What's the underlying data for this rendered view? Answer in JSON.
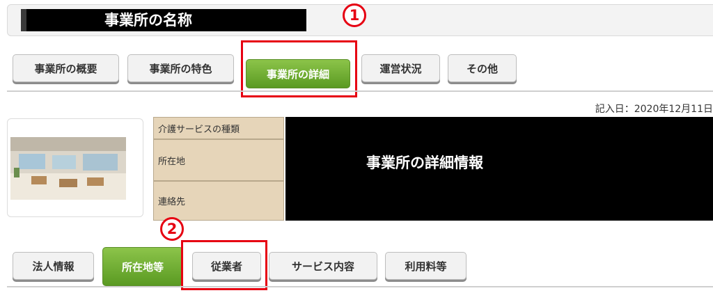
{
  "header": {
    "facility_name": "事業所の名称"
  },
  "main_tabs": [
    {
      "label": "事業所の概要",
      "active": false
    },
    {
      "label": "事業所の特色",
      "active": false
    },
    {
      "label": "事業所の詳細",
      "active": true
    },
    {
      "label": "運営状況",
      "active": false
    },
    {
      "label": "その他",
      "active": false
    }
  ],
  "annotations": {
    "marker1": "1",
    "marker2": "2",
    "highlight_color": "#e60012"
  },
  "entry_date": "記入日：2020年12月11日",
  "info": {
    "rows": [
      {
        "label": "介護サービスの種類"
      },
      {
        "label": "所在地"
      },
      {
        "label": "連絡先"
      }
    ],
    "detail_overlay": "事業所の詳細情報"
  },
  "sub_tabs": [
    {
      "label": "法人情報",
      "active": false
    },
    {
      "label": "所在地等",
      "active": true
    },
    {
      "label": "従業者",
      "active": false
    },
    {
      "label": "サービス内容",
      "active": false
    },
    {
      "label": "利用料等",
      "active": false
    }
  ],
  "colors": {
    "active_tab": "#6aab2e",
    "info_label_bg": "#e6d5b9"
  }
}
